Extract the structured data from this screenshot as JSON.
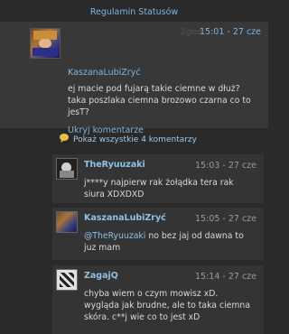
{
  "header": {
    "title": "Regulamin Statusów"
  },
  "post": {
    "report_label": "Zgłoś",
    "time": "15:01 - 27 cze",
    "author": "KaszanaLubiZryć",
    "text": "ej macie pod fujarą takie ciemne w dłuż? taka poszlaka ciemna brozowo czarna co to jesT?",
    "hide_comments": "Ukryj komentarze"
  },
  "show_all": {
    "label": "Pokaż wszystkie 4 komentarzy",
    "icon": "speech-bubble-icon"
  },
  "comments": [
    {
      "author": "TheRyuuzaki",
      "time": "15:03 - 27 cze",
      "text": "j****y najpierw rak żołądka tera rak siura XDXDXD"
    },
    {
      "author": "KaszanaLubiZryć",
      "time": "15:05 - 27 cze",
      "mention": "@TheRyuuzaki",
      "text": " no bez jaj od dawna to juz mam"
    },
    {
      "author": "ZagajQ",
      "time": "15:14 - 27 cze",
      "text": "chyba wiem o czym mowisz xD. wygląda jak brudne, ale to taka ciemna skóra. c**j wie co to jest xD"
    }
  ]
}
